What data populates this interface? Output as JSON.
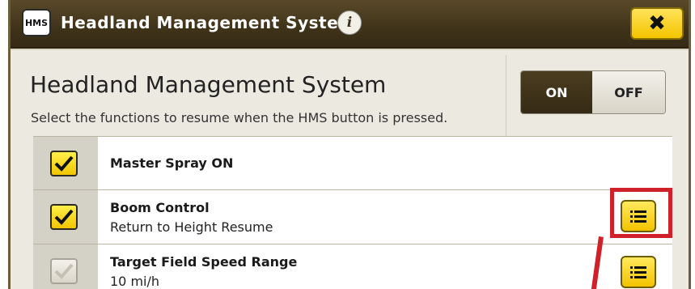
{
  "titlebar": {
    "logo_text": "HMS",
    "title": "Headland Management System",
    "info_icon": "info-icon",
    "close_symbol": "✖",
    "close_icon": "close-icon"
  },
  "main": {
    "heading": "Headland Management System",
    "subtitle": "Select the functions to resume when the HMS button is pressed.",
    "toggle": {
      "on_label": "ON",
      "off_label": "OFF",
      "selected": "ON"
    }
  },
  "functions": [
    {
      "title": "Master Spray ON",
      "subtitle": "",
      "checked": true,
      "has_settings": false
    },
    {
      "title": "Boom Control",
      "subtitle": "Return to Height Resume",
      "checked": true,
      "has_settings": true
    },
    {
      "title": "Target Field Speed Range",
      "subtitle": "10 mi/h",
      "checked": false,
      "has_settings": true
    }
  ],
  "colors": {
    "titlebar": "#3f3319",
    "accent_yellow": "#f4c400",
    "highlight_red": "#d0202a"
  }
}
